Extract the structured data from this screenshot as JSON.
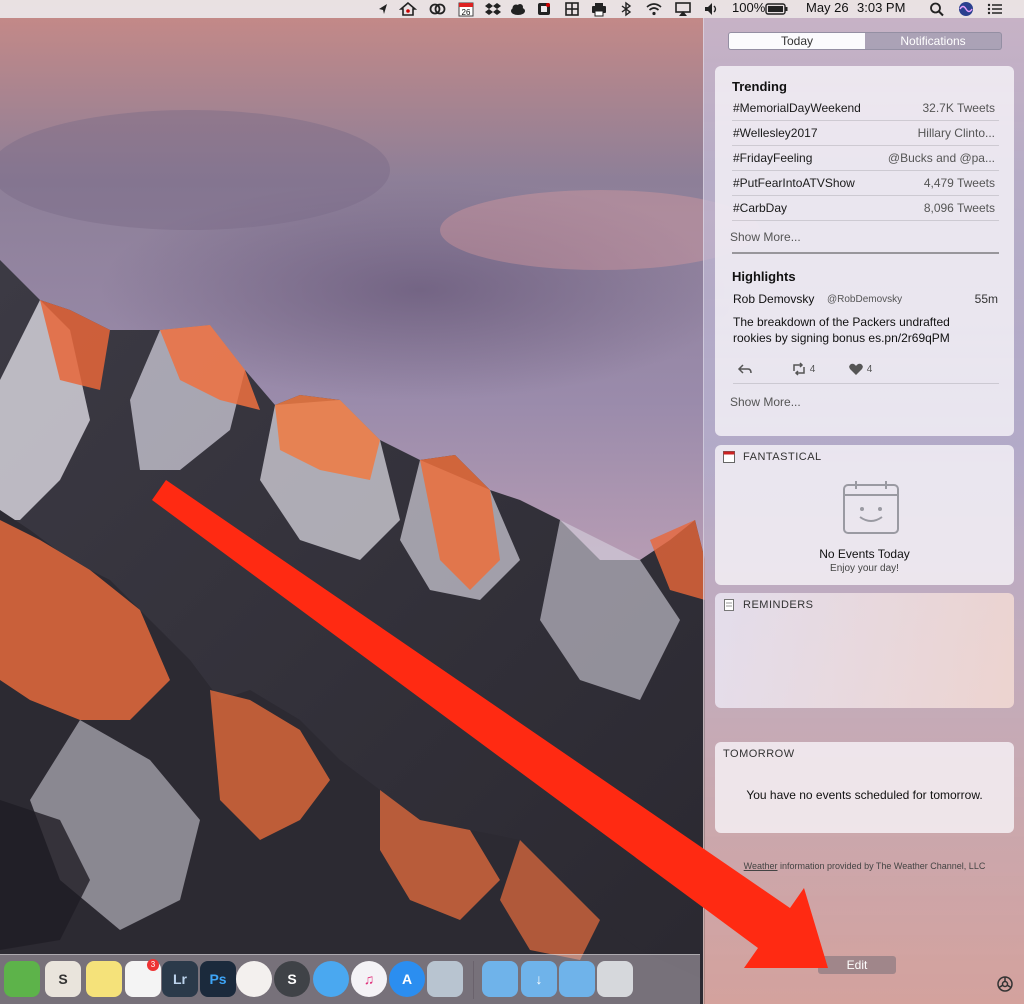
{
  "menubar": {
    "battery_percent": "100%",
    "date": "May 26",
    "time": "3:03 PM",
    "calendar_day": "26",
    "icons": [
      "location-icon",
      "home-icon",
      "creative-cloud-icon",
      "calendar-icon",
      "dropbox-icon",
      "cloud-icon",
      "evernote-icon",
      "grid-icon",
      "printer-icon",
      "bluetooth-icon",
      "wifi-icon",
      "airplay-icon",
      "volume-icon",
      "battery-icon",
      "spotlight-icon",
      "siri-icon",
      "list-icon"
    ]
  },
  "notification_center": {
    "tabs": [
      {
        "label": "Today",
        "selected": true
      },
      {
        "label": "Notifications",
        "selected": false
      }
    ],
    "twitter": {
      "trending_title": "Trending",
      "trends": [
        {
          "tag": "#MemorialDayWeekend",
          "meta": "32.7K Tweets"
        },
        {
          "tag": "#Wellesley2017",
          "meta": "Hillary Clinto..."
        },
        {
          "tag": "#FridayFeeling",
          "meta": "@Bucks and @pa..."
        },
        {
          "tag": "#PutFearIntoATVShow",
          "meta": "4,479 Tweets"
        },
        {
          "tag": "#CarbDay",
          "meta": "8,096 Tweets"
        }
      ],
      "show_more_1": "Show More...",
      "highlights_title": "Highlights",
      "tweet": {
        "name": "Rob Demovsky",
        "handle": "@RobDemovsky",
        "time": "55m",
        "text": "The breakdown of the Packers undrafted rookies by signing bonus es.pn/2r69qPM",
        "retweets": "4",
        "likes": "4"
      },
      "show_more_2": "Show More..."
    },
    "fantastical": {
      "title": "FANTASTICAL",
      "empty_title": "No Events Today",
      "empty_sub": "Enjoy your day!"
    },
    "reminders": {
      "title": "REMINDERS"
    },
    "tomorrow": {
      "title": "TOMORROW",
      "text": "You have no events scheduled for tomorrow."
    },
    "weather_credit_link": "Weather",
    "weather_credit_rest": " information provided by The Weather Channel, LLC",
    "edit_label": "Edit"
  },
  "dock": {
    "items": [
      {
        "name": "evernote",
        "color": "#5db34a",
        "glyph": ""
      },
      {
        "name": "slack",
        "color": "#e9e4dc",
        "glyph": "S"
      },
      {
        "name": "notes",
        "color": "#f5e27a",
        "glyph": ""
      },
      {
        "name": "reminders",
        "color": "#f4f4f4",
        "glyph": "",
        "badge": "3"
      },
      {
        "name": "lightroom",
        "color": "#2b3a4a",
        "glyph": "Lr"
      },
      {
        "name": "photoshop",
        "color": "#1b2a3c",
        "glyph": "Ps"
      },
      {
        "name": "photos",
        "color": "#f3f0ee",
        "glyph": ""
      },
      {
        "name": "sonos",
        "color": "#3f4247",
        "glyph": "S"
      },
      {
        "name": "messages",
        "color": "#4aa8f0",
        "glyph": ""
      },
      {
        "name": "itunes",
        "color": "#f4f2f6",
        "glyph": "♫"
      },
      {
        "name": "app-store",
        "color": "#2b8ef0",
        "glyph": "A"
      },
      {
        "name": "preview",
        "color": "#b8c4d0",
        "glyph": ""
      },
      {
        "name": "applications-folder",
        "color": "#6fb3ea",
        "glyph": ""
      },
      {
        "name": "downloads-folder",
        "color": "#6fb3ea",
        "glyph": ""
      },
      {
        "name": "documents-folder",
        "color": "#6fb3ea",
        "glyph": ""
      },
      {
        "name": "trash",
        "color": "#d6d8dc",
        "glyph": ""
      }
    ]
  },
  "colors": {
    "arrow": "#ff2a12",
    "menubar": "#ece8ea"
  }
}
